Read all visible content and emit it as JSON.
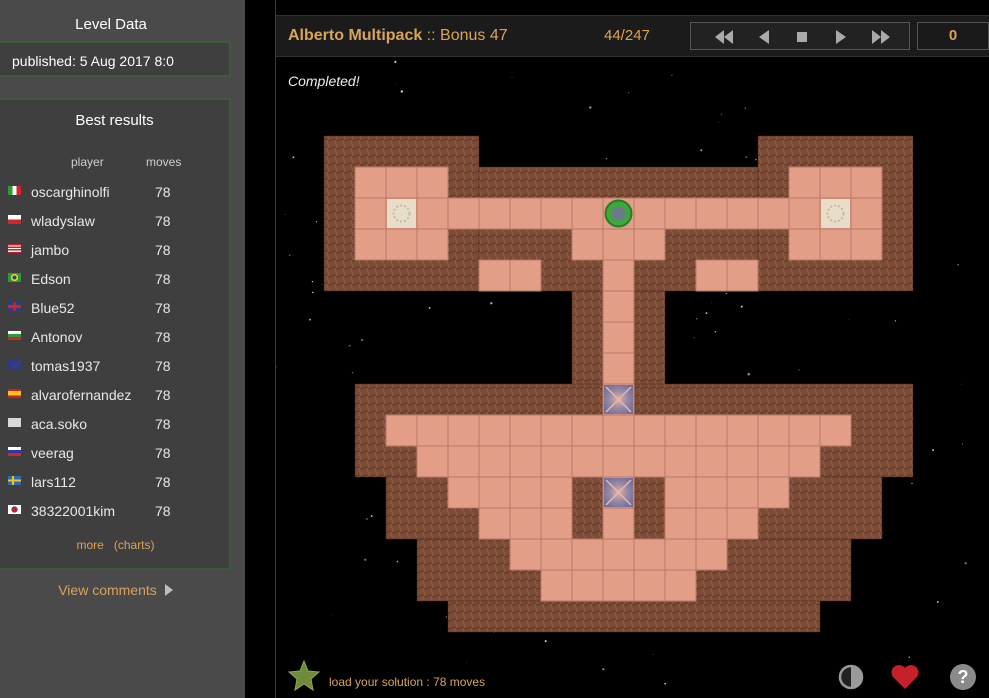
{
  "sidebar": {
    "level_data_title": "Level Data",
    "published": "published: 5 Aug 2017 8:0",
    "best_results_title": "Best results",
    "col_player": "player",
    "col_moves": "moves",
    "results": [
      {
        "player": "oscarghinolfi",
        "moves": "78",
        "flag": "italy-flag"
      },
      {
        "player": "wladyslaw",
        "moves": "78",
        "flag": "poland-flag"
      },
      {
        "player": "jambo",
        "moves": "78",
        "flag": "usa-flag"
      },
      {
        "player": "Edson",
        "moves": "78",
        "flag": "brazil-flag"
      },
      {
        "player": "Blue52",
        "moves": "78",
        "flag": "uk-flag"
      },
      {
        "player": "Antonov",
        "moves": "78",
        "flag": "bulgaria-flag"
      },
      {
        "player": "tomas1937",
        "moves": "78",
        "flag": "australia-flag"
      },
      {
        "player": "alvarofernandez",
        "moves": "78",
        "flag": "spain-flag"
      },
      {
        "player": "aca.soko",
        "moves": "78",
        "flag": "blank-flag"
      },
      {
        "player": "veerag",
        "moves": "78",
        "flag": "russia-flag"
      },
      {
        "player": "lars112",
        "moves": "78",
        "flag": "sweden-flag"
      },
      {
        "player": "38322001kim",
        "moves": "78",
        "flag": "korea-flag"
      }
    ],
    "more_label": "more",
    "charts_label": "(charts)",
    "view_comments": "View comments"
  },
  "game": {
    "collection": "Alberto Multipack",
    "separator": " :: ",
    "level_name": "Bonus 47",
    "level_counter": "44/247",
    "move_count": "0",
    "status": "Completed!",
    "load_solution": "load your solution : 78 moves"
  },
  "colors": {
    "accent": "#d9a35a",
    "floor": "#e09a85",
    "wall": "#7a4a35",
    "player": "#3fa83a"
  },
  "icons": [
    "fast-rewind-icon",
    "step-back-icon",
    "stop-icon",
    "step-forward-icon",
    "fast-forward-icon",
    "star-icon",
    "contrast-icon",
    "heart-icon",
    "help-icon",
    "arrow-right-icon"
  ]
}
